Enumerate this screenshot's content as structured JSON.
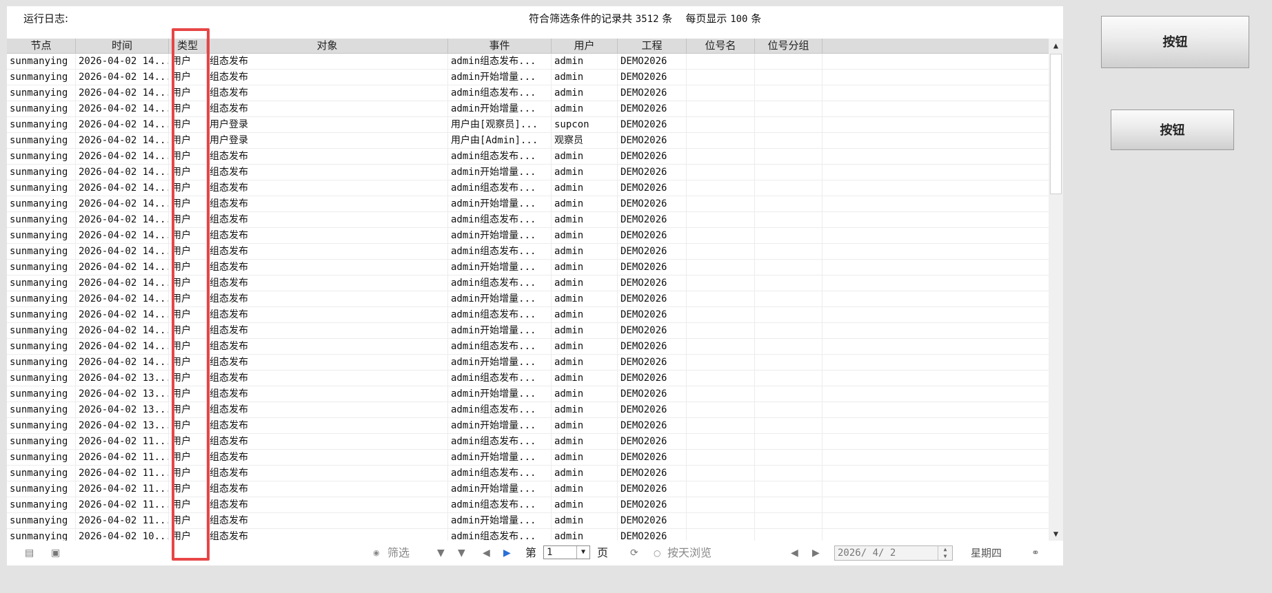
{
  "top": {
    "title": "运行日志:",
    "summary_prefix": "符合筛选条件的记录共",
    "record_count": "3512",
    "summary_unit": "条",
    "per_page_label": "每页显示",
    "per_page": "100",
    "per_page_unit": "条"
  },
  "table": {
    "columns": [
      "节点",
      "时间",
      "类型",
      "对象",
      "事件",
      "用户",
      "工程",
      "位号名",
      "位号分组"
    ],
    "rows": [
      [
        "sunmanying",
        "2026-04-02 14...",
        "用户",
        "组态发布",
        "admin组态发布...",
        "admin",
        "DEMO2026"
      ],
      [
        "sunmanying",
        "2026-04-02 14...",
        "用户",
        "组态发布",
        "admin开始增量...",
        "admin",
        "DEMO2026"
      ],
      [
        "sunmanying",
        "2026-04-02 14...",
        "用户",
        "组态发布",
        "admin组态发布...",
        "admin",
        "DEMO2026"
      ],
      [
        "sunmanying",
        "2026-04-02 14...",
        "用户",
        "组态发布",
        "admin开始增量...",
        "admin",
        "DEMO2026"
      ],
      [
        "sunmanying",
        "2026-04-02 14...",
        "用户",
        "用户登录",
        "用户由[观察员]...",
        "supcon",
        "DEMO2026"
      ],
      [
        "sunmanying",
        "2026-04-02 14...",
        "用户",
        "用户登录",
        "用户由[Admin]...",
        "观察员",
        "DEMO2026"
      ],
      [
        "sunmanying",
        "2026-04-02 14...",
        "用户",
        "组态发布",
        "admin组态发布...",
        "admin",
        "DEMO2026"
      ],
      [
        "sunmanying",
        "2026-04-02 14...",
        "用户",
        "组态发布",
        "admin开始增量...",
        "admin",
        "DEMO2026"
      ],
      [
        "sunmanying",
        "2026-04-02 14...",
        "用户",
        "组态发布",
        "admin组态发布...",
        "admin",
        "DEMO2026"
      ],
      [
        "sunmanying",
        "2026-04-02 14...",
        "用户",
        "组态发布",
        "admin开始增量...",
        "admin",
        "DEMO2026"
      ],
      [
        "sunmanying",
        "2026-04-02 14...",
        "用户",
        "组态发布",
        "admin组态发布...",
        "admin",
        "DEMO2026"
      ],
      [
        "sunmanying",
        "2026-04-02 14...",
        "用户",
        "组态发布",
        "admin开始增量...",
        "admin",
        "DEMO2026"
      ],
      [
        "sunmanying",
        "2026-04-02 14...",
        "用户",
        "组态发布",
        "admin组态发布...",
        "admin",
        "DEMO2026"
      ],
      [
        "sunmanying",
        "2026-04-02 14...",
        "用户",
        "组态发布",
        "admin开始增量...",
        "admin",
        "DEMO2026"
      ],
      [
        "sunmanying",
        "2026-04-02 14...",
        "用户",
        "组态发布",
        "admin组态发布...",
        "admin",
        "DEMO2026"
      ],
      [
        "sunmanying",
        "2026-04-02 14...",
        "用户",
        "组态发布",
        "admin开始增量...",
        "admin",
        "DEMO2026"
      ],
      [
        "sunmanying",
        "2026-04-02 14...",
        "用户",
        "组态发布",
        "admin组态发布...",
        "admin",
        "DEMO2026"
      ],
      [
        "sunmanying",
        "2026-04-02 14...",
        "用户",
        "组态发布",
        "admin开始增量...",
        "admin",
        "DEMO2026"
      ],
      [
        "sunmanying",
        "2026-04-02 14...",
        "用户",
        "组态发布",
        "admin组态发布...",
        "admin",
        "DEMO2026"
      ],
      [
        "sunmanying",
        "2026-04-02 14...",
        "用户",
        "组态发布",
        "admin开始增量...",
        "admin",
        "DEMO2026"
      ],
      [
        "sunmanying",
        "2026-04-02 13...",
        "用户",
        "组态发布",
        "admin组态发布...",
        "admin",
        "DEMO2026"
      ],
      [
        "sunmanying",
        "2026-04-02 13...",
        "用户",
        "组态发布",
        "admin开始增量...",
        "admin",
        "DEMO2026"
      ],
      [
        "sunmanying",
        "2026-04-02 13...",
        "用户",
        "组态发布",
        "admin组态发布...",
        "admin",
        "DEMO2026"
      ],
      [
        "sunmanying",
        "2026-04-02 13...",
        "用户",
        "组态发布",
        "admin开始增量...",
        "admin",
        "DEMO2026"
      ],
      [
        "sunmanying",
        "2026-04-02 11...",
        "用户",
        "组态发布",
        "admin组态发布...",
        "admin",
        "DEMO2026"
      ],
      [
        "sunmanying",
        "2026-04-02 11...",
        "用户",
        "组态发布",
        "admin开始增量...",
        "admin",
        "DEMO2026"
      ],
      [
        "sunmanying",
        "2026-04-02 11...",
        "用户",
        "组态发布",
        "admin组态发布...",
        "admin",
        "DEMO2026"
      ],
      [
        "sunmanying",
        "2026-04-02 11...",
        "用户",
        "组态发布",
        "admin开始增量...",
        "admin",
        "DEMO2026"
      ],
      [
        "sunmanying",
        "2026-04-02 11...",
        "用户",
        "组态发布",
        "admin组态发布...",
        "admin",
        "DEMO2026"
      ],
      [
        "sunmanying",
        "2026-04-02 11...",
        "用户",
        "组态发布",
        "admin开始增量...",
        "admin",
        "DEMO2026"
      ],
      [
        "sunmanying",
        "2026-04-02 10...",
        "用户",
        "组态发布",
        "admin组态发布...",
        "admin",
        "DEMO2026"
      ]
    ]
  },
  "footer": {
    "filter_label": "筛选",
    "page_prefix": "第",
    "page_value": "1",
    "page_suffix": "页",
    "by_day_label": "按天浏览",
    "date_value": "2026/ 4/ 2",
    "weekday": "星期四"
  },
  "buttons": {
    "btn1_label": "按钮",
    "btn2_label": "按钮"
  },
  "colors": {
    "highlight": "#e84545",
    "header_bg": "#dcdcdc",
    "page_bg": "#e3e3e3"
  }
}
